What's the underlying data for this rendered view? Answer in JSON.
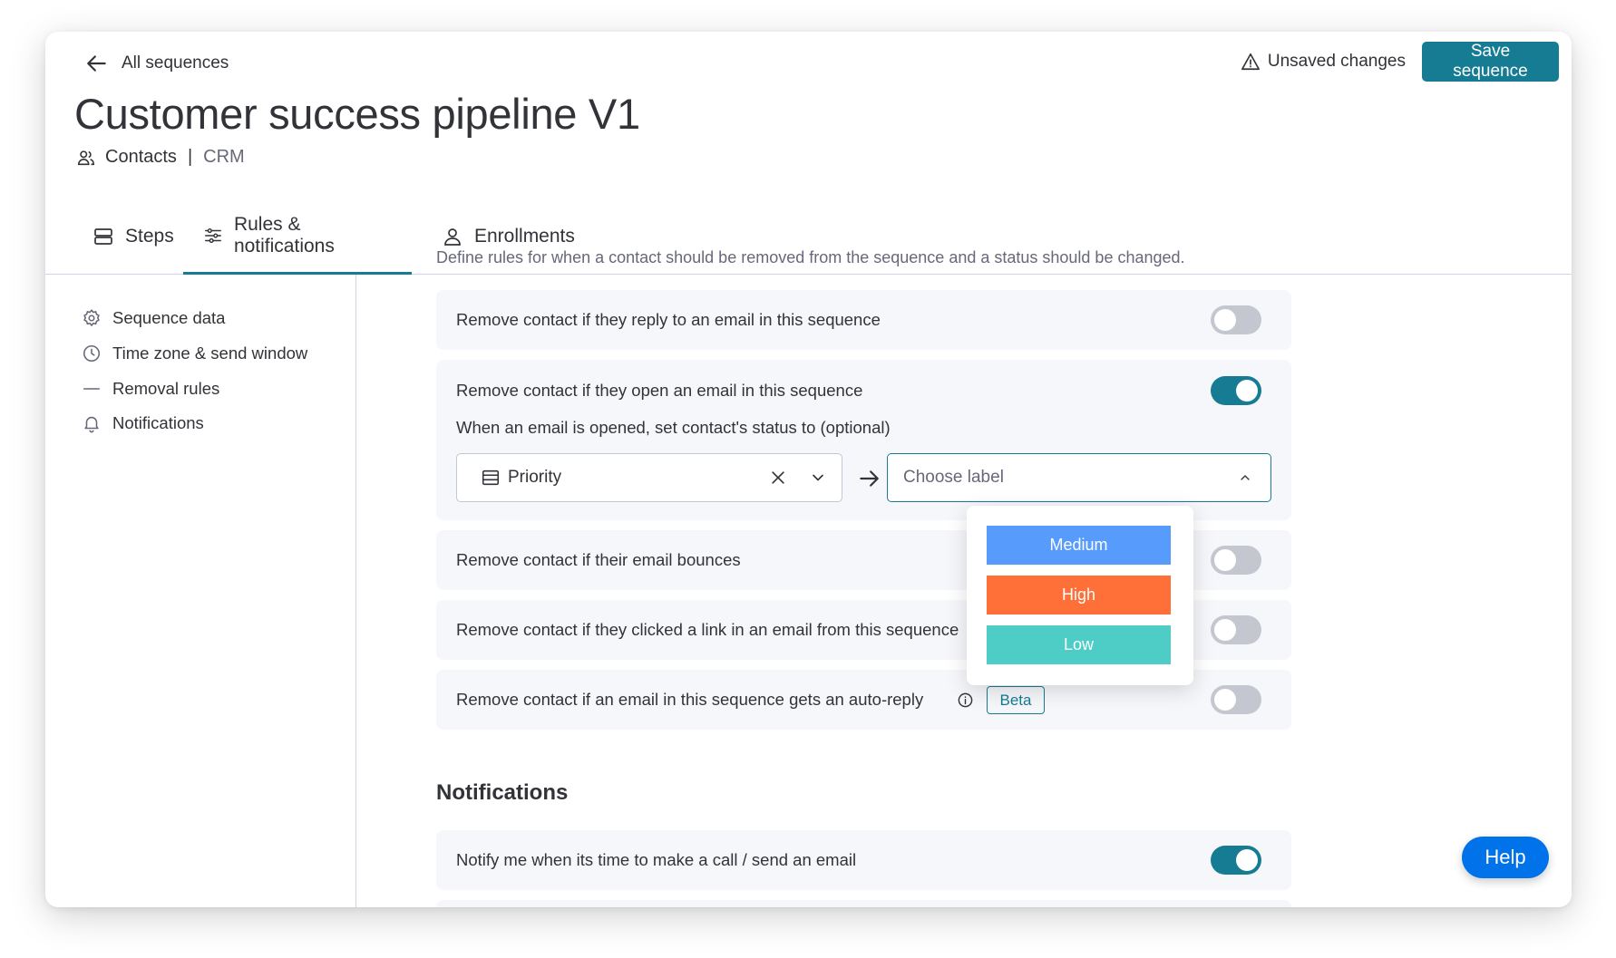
{
  "header": {
    "back_label": "All sequences",
    "unsaved_label": "Unsaved changes",
    "save_label": "Save sequence",
    "title": "Customer success pipeline V1",
    "board": "Contacts",
    "separator": "|",
    "workspace": "CRM"
  },
  "tabs": [
    {
      "label": "Steps",
      "icon": "steps-icon"
    },
    {
      "label": "Rules & notifications",
      "icon": "sliders-icon",
      "active": true
    },
    {
      "label": "Enrollments",
      "icon": "person-icon"
    }
  ],
  "sidebar": {
    "items": [
      {
        "label": "Sequence data",
        "icon": "gear-icon"
      },
      {
        "label": "Time zone & send window",
        "icon": "clock-icon"
      },
      {
        "label": "Removal rules",
        "icon": "dash-icon"
      },
      {
        "label": "Notifications",
        "icon": "bell-icon"
      }
    ]
  },
  "removal": {
    "description": "Define rules for when a contact should be removed from the sequence and a status should be changed.",
    "rules": [
      {
        "label": "Remove contact if they reply to an email in this sequence",
        "enabled": false
      },
      {
        "label": "Remove contact if they open an email in this sequence",
        "enabled": true
      },
      {
        "label": "Remove contact if their email bounces",
        "enabled": false
      },
      {
        "label": "Remove contact if they clicked a link in an email from this sequence",
        "enabled": false
      },
      {
        "label": "Remove contact if an email in this sequence gets an auto-reply",
        "enabled": false
      }
    ],
    "status_prompt": "When an email is opened, set contact's status to (optional)",
    "column_select": {
      "value": "Priority"
    },
    "label_select": {
      "placeholder": "Choose label"
    },
    "beta_badge": "Beta"
  },
  "label_options": [
    {
      "label": "Medium",
      "color": "#579bfc"
    },
    {
      "label": "High",
      "color": "#ff7038"
    },
    {
      "label": "Low",
      "color": "#4eccc6"
    }
  ],
  "notifications": {
    "heading": "Notifications",
    "items": [
      {
        "label": "Notify me when its time to make a call / send an email",
        "enabled": true
      }
    ]
  },
  "help_label": "Help",
  "colors": {
    "accent": "#167c93",
    "help": "#0073ea",
    "toggle_off": "#c5c7d0"
  }
}
